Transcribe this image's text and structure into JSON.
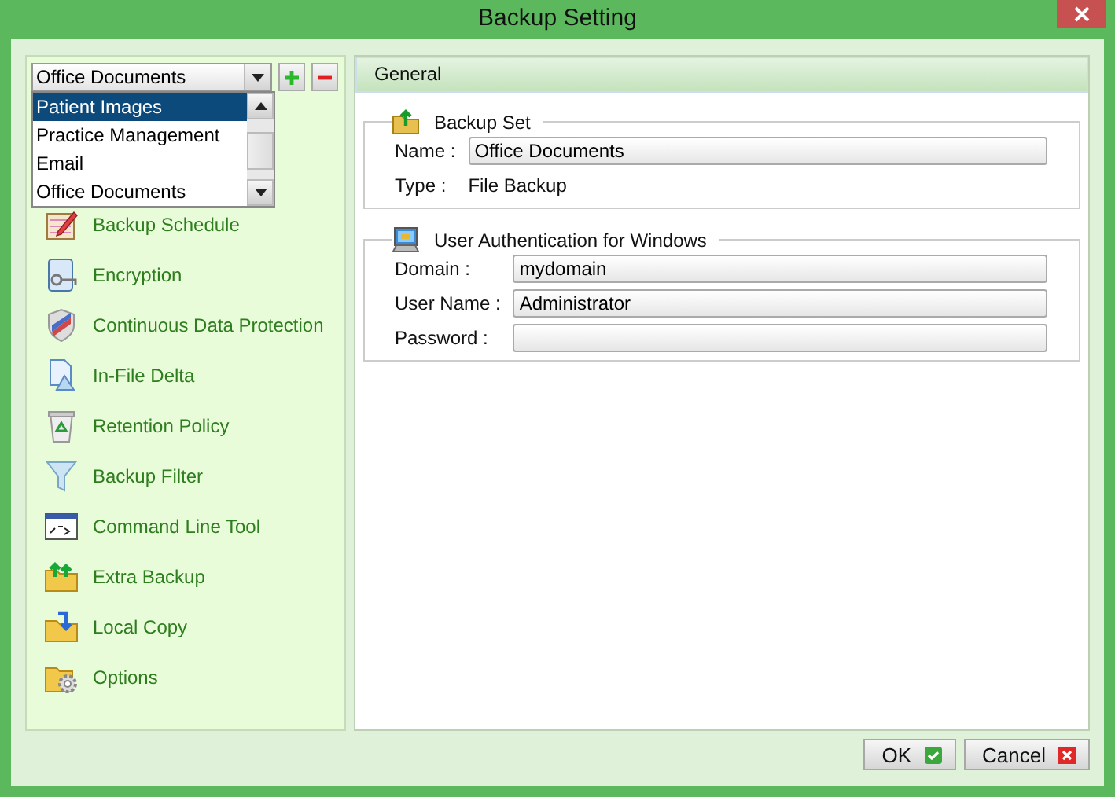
{
  "window": {
    "title": "Backup Setting"
  },
  "backup_set_selector": {
    "value": "Office Documents",
    "options": [
      {
        "label": "Patient Images",
        "highlighted": true
      },
      {
        "label": "Practice Management",
        "highlighted": false
      },
      {
        "label": "Email",
        "highlighted": false
      },
      {
        "label": "Office Documents",
        "highlighted": false
      }
    ]
  },
  "sidebar": {
    "items": [
      {
        "label": "Backup Schedule"
      },
      {
        "label": "Encryption"
      },
      {
        "label": "Continuous Data Protection"
      },
      {
        "label": "In-File Delta"
      },
      {
        "label": "Retention Policy"
      },
      {
        "label": "Backup Filter"
      },
      {
        "label": "Command Line Tool"
      },
      {
        "label": "Extra Backup"
      },
      {
        "label": "Local Copy"
      },
      {
        "label": "Options"
      }
    ]
  },
  "panel": {
    "title": "General",
    "sections": [
      {
        "title": "Backup Set",
        "kind": "folder",
        "fields": [
          {
            "label": "Name :",
            "kind": "input",
            "value": "Office Documents"
          },
          {
            "label": "Type :",
            "kind": "text",
            "value": "File Backup"
          }
        ]
      },
      {
        "title": "User Authentication for Windows",
        "kind": "computer",
        "fields": [
          {
            "label": "Domain :",
            "kind": "input",
            "value": "mydomain"
          },
          {
            "label": "User Name :",
            "kind": "input",
            "value": "Administrator"
          },
          {
            "label": "Password :",
            "kind": "input"
          }
        ]
      }
    ]
  },
  "buttons": [
    {
      "label": "OK",
      "kind": "ok"
    },
    {
      "label": "Cancel",
      "kind": "cancel"
    }
  ]
}
